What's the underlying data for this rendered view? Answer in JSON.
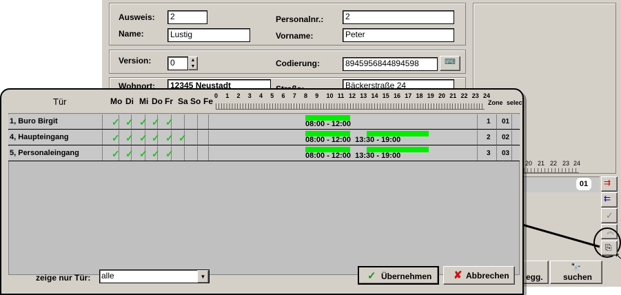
{
  "form": {
    "ausweis_label": "Ausweis:",
    "ausweis_value": "2",
    "personalnr_label": "Personalnr.:",
    "personalnr_value": "2",
    "name_label": "Name:",
    "name_value": "Lustig",
    "vorname_label": "Vorname:",
    "vorname_value": "Peter",
    "version_label": "Version:",
    "version_value": "0",
    "codierung_label": "Codierung:",
    "codierung_value": "8945956844894598",
    "wohnort_label": "Wohnort:",
    "wohnort_value": "12345 Neustadt",
    "strasse_label": "Straße:",
    "strasse_value": "Bäckerstraße 24"
  },
  "background_ruler": {
    "ticks": [
      "20",
      "21",
      "22",
      "23",
      "24"
    ],
    "badge": "01"
  },
  "background_buttons": {
    "egg_label": "egg.",
    "suchen_label": "suchen"
  },
  "popup": {
    "headers": {
      "tuer": "Tür",
      "zone": "Zone",
      "select": "select",
      "days": [
        "Mo",
        "Di",
        "Mi",
        "Do",
        "Fr",
        "Sa",
        "So",
        "Fe"
      ]
    },
    "hour_ticks": [
      "0",
      "1",
      "2",
      "3",
      "4",
      "5",
      "6",
      "7",
      "8",
      "9",
      "10",
      "11",
      "12",
      "13",
      "14",
      "15",
      "16",
      "17",
      "18",
      "19",
      "20",
      "21",
      "22",
      "23",
      "24"
    ],
    "rows": [
      {
        "tuer": "1, Buro Birgit",
        "days": [
          true,
          true,
          true,
          true,
          true,
          false,
          false,
          false
        ],
        "times": "08:00 - 12:00",
        "zone": "1",
        "select": "01",
        "bars": [
          {
            "from": 8,
            "to": 12
          }
        ]
      },
      {
        "tuer": "4, Haupteingang",
        "days": [
          true,
          true,
          true,
          true,
          true,
          true,
          false,
          false
        ],
        "times": "08:00 - 12:00  13:30 - 19:00",
        "zone": "2",
        "select": "02",
        "bars": [
          {
            "from": 8,
            "to": 12
          },
          {
            "from": 13.5,
            "to": 19
          }
        ]
      },
      {
        "tuer": "5, Personaleingang",
        "days": [
          true,
          true,
          true,
          true,
          true,
          false,
          false,
          false
        ],
        "times": "08:00 - 12:00  13:30 - 19:00",
        "zone": "3",
        "select": "03",
        "bars": [
          {
            "from": 8,
            "to": 12
          },
          {
            "from": 13.5,
            "to": 19
          }
        ]
      }
    ],
    "filter_label": "zeige nur Tür:",
    "filter_value": "alle",
    "ok_label": "Übernehmen",
    "cancel_label": "Abbrechen"
  },
  "colors": {
    "bar": "#00ee00",
    "check": "#22c022",
    "cancel_x": "#d01010"
  }
}
